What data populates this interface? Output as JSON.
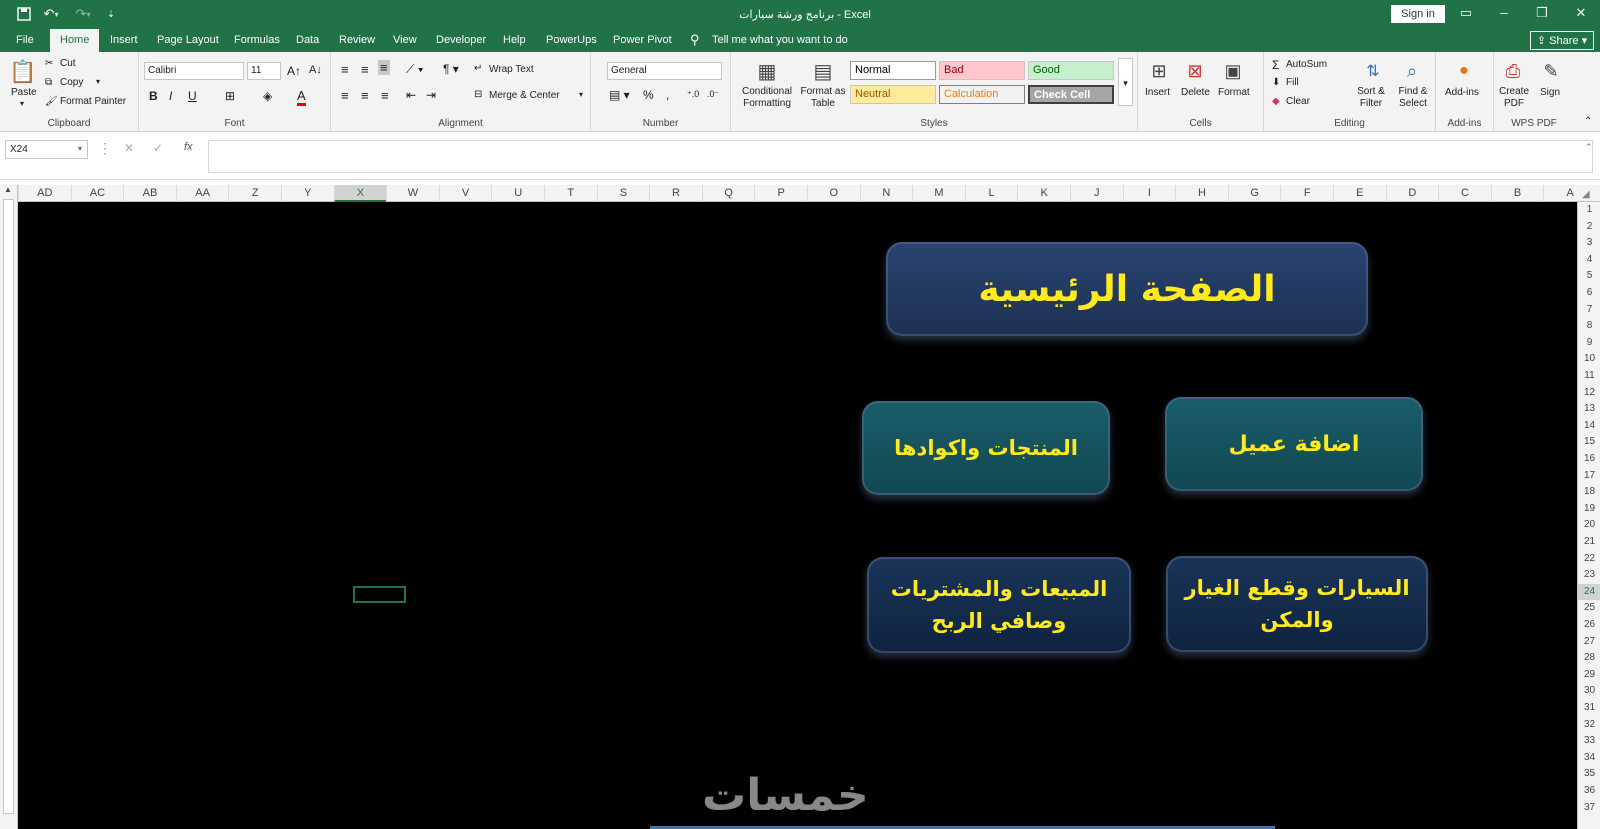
{
  "titlebar": {
    "title": "برنامج ورشة سيارات  -  Excel",
    "signin": "Sign in",
    "icons": [
      "save-icon",
      "undo-icon",
      "redo-icon",
      "customize-icon",
      "ribbon-display-icon",
      "minimize-icon",
      "restore-icon",
      "close-icon"
    ]
  },
  "tabs": {
    "file": "File",
    "home": "Home",
    "insert": "Insert",
    "page_layout": "Page Layout",
    "formulas": "Formulas",
    "data": "Data",
    "review": "Review",
    "view": "View",
    "developer": "Developer",
    "help": "Help",
    "powerups": "PowerUps",
    "power_pivot": "Power Pivot",
    "tell_me": "Tell me what you want to do",
    "share": "Share"
  },
  "ribbon": {
    "clipboard": {
      "label": "Clipboard",
      "paste": "Paste",
      "cut": "Cut",
      "copy": "Copy",
      "format_painter": "Format Painter"
    },
    "font": {
      "label": "Font",
      "name": "Calibri",
      "size": "11",
      "bold": "B",
      "italic": "I",
      "underline": "U",
      "color_letter": "A"
    },
    "alignment": {
      "label": "Alignment",
      "wrap_text": "Wrap Text",
      "merge_center": "Merge & Center"
    },
    "number": {
      "label": "Number",
      "format": "General",
      "percent": "%",
      "comma": ","
    },
    "styles": {
      "label": "Styles",
      "conditional": "Conditional Formatting",
      "format_table": "Format as Table",
      "normal": "Normal",
      "bad": "Bad",
      "good": "Good",
      "neutral": "Neutral",
      "calculation": "Calculation",
      "check_cell": "Check Cell"
    },
    "cells": {
      "label": "Cells",
      "insert": "Insert",
      "delete": "Delete",
      "format": "Format"
    },
    "editing": {
      "label": "Editing",
      "autosum": "AutoSum",
      "fill": "Fill",
      "clear": "Clear",
      "sort_filter": "Sort & Filter",
      "find_select": "Find & Select"
    },
    "addins": {
      "label": "Add-ins",
      "addins": "Add-ins"
    },
    "wps": {
      "label": "WPS PDF",
      "create_pdf": "Create PDF",
      "sign": "Sign"
    }
  },
  "formula_bar": {
    "name_box": "X24",
    "fx": "fx",
    "value": ""
  },
  "columns": [
    "AD",
    "AC",
    "AB",
    "AA",
    "Z",
    "Y",
    "X",
    "W",
    "V",
    "U",
    "T",
    "S",
    "R",
    "Q",
    "P",
    "O",
    "N",
    "M",
    "L",
    "K",
    "J",
    "I",
    "H",
    "G",
    "F",
    "E",
    "D",
    "C",
    "B",
    "A"
  ],
  "selected_column": "X",
  "rows": [
    "1",
    "2",
    "3",
    "4",
    "5",
    "6",
    "7",
    "8",
    "9",
    "10",
    "11",
    "12",
    "13",
    "14",
    "15",
    "16",
    "17",
    "18",
    "19",
    "20",
    "21",
    "22",
    "23",
    "24",
    "25",
    "26",
    "27",
    "28",
    "29",
    "30",
    "31",
    "32",
    "33",
    "34",
    "35",
    "36",
    "37"
  ],
  "selected_row": "24",
  "sheet": {
    "main_title": "الصفحة الرئيسية",
    "btn_add_customer": "اضافة عميل",
    "btn_products": "المنتجات واكوادها",
    "btn_cars_parts_line1": "السيارات وقطع الغيار",
    "btn_cars_parts_line2": "والمكن",
    "btn_sales_line1": "المبيعات والمشتريات",
    "btn_sales_line2": "وصافي الربح",
    "watermark": "خمسات"
  },
  "colors": {
    "excel_green": "#217346",
    "sheet_bg": "#000000",
    "button_text": "#ffe91f",
    "title_card": "#22385a",
    "teal_card": "#15505a",
    "navy_card": "#142745"
  }
}
